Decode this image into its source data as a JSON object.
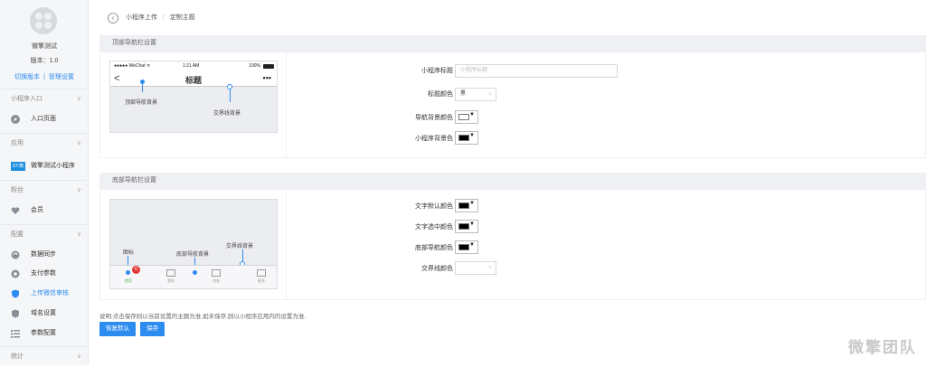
{
  "sidebar": {
    "app_name": "微擎测试",
    "version": "版本：1.0",
    "switch_link": "切换版本",
    "link_sep": "|",
    "manage_link": "管理设置",
    "groups": [
      {
        "label": "小程序入口",
        "items": [
          {
            "label": "入口页面",
            "icon": "compass-icon"
          }
        ]
      },
      {
        "label": "应用",
        "items": [
          {
            "label": "微擎测试小程序",
            "icon": "app-banner-icon"
          }
        ]
      },
      {
        "label": "粉丝",
        "items": [
          {
            "label": "会员",
            "icon": "heart-icon"
          }
        ]
      },
      {
        "label": "配置",
        "items": [
          {
            "label": "数据同步",
            "icon": "sync-icon"
          },
          {
            "label": "支付参数",
            "icon": "gear-icon"
          },
          {
            "label": "上传微信审核",
            "icon": "shield-icon",
            "active": true
          },
          {
            "label": "域名设置",
            "icon": "shield-icon"
          },
          {
            "label": "参数配置",
            "icon": "list-icon"
          }
        ]
      },
      {
        "label": "统计",
        "items": []
      }
    ],
    "banner_text": "ST:微"
  },
  "breadcrumb": {
    "parent": "小程序上传",
    "sep": "/",
    "current": "定制主题"
  },
  "top_section": {
    "title": "顶部导航栏设置",
    "phone": {
      "carrier": "●●●●● WeChat ᯤ",
      "time": "1:21 AM",
      "battery": "100%",
      "nav_title": "标题",
      "back_glyph": "<",
      "more_glyph": "•••",
      "anno_nav_bg": "顶部导航背景",
      "anno_border": "交界线背景"
    },
    "fields": {
      "title_label": "小程序标题",
      "title_placeholder": "小程序标题",
      "title_color_label": "标题颜色",
      "title_color_value": "黑",
      "nav_bg_label": "导航背景颜色",
      "nav_bg_color": "#ffffff",
      "app_bg_label": "小程序背景色",
      "app_bg_color": "#000000"
    }
  },
  "bottom_section": {
    "title": "底部导航栏设置",
    "phone": {
      "anno_icon": "图标",
      "anno_tab_bg": "底部导航背景",
      "anno_border": "交界线背景",
      "badge": "6",
      "tabs": [
        "首页",
        "我的",
        "消息",
        "更多"
      ]
    },
    "fields": {
      "text_default_label": "文字默认颜色",
      "text_default_color": "#000000",
      "text_selected_label": "文字选中颜色",
      "text_selected_color": "#000000",
      "tab_bg_label": "底部导航颜色",
      "tab_bg_color": "#000000",
      "border_label": "交界线颜色",
      "border_value": ""
    }
  },
  "note": "说明:点击保存则以当前设置的主题为准,如未保存,则以小程序应用内的设置为准.",
  "buttons": {
    "restore": "恢复默认",
    "save": "保存"
  },
  "watermark": "微擎团队",
  "colors": {
    "accent": "#2d8cf0",
    "badge": "#e53935",
    "tab_active": "#39b54a"
  }
}
